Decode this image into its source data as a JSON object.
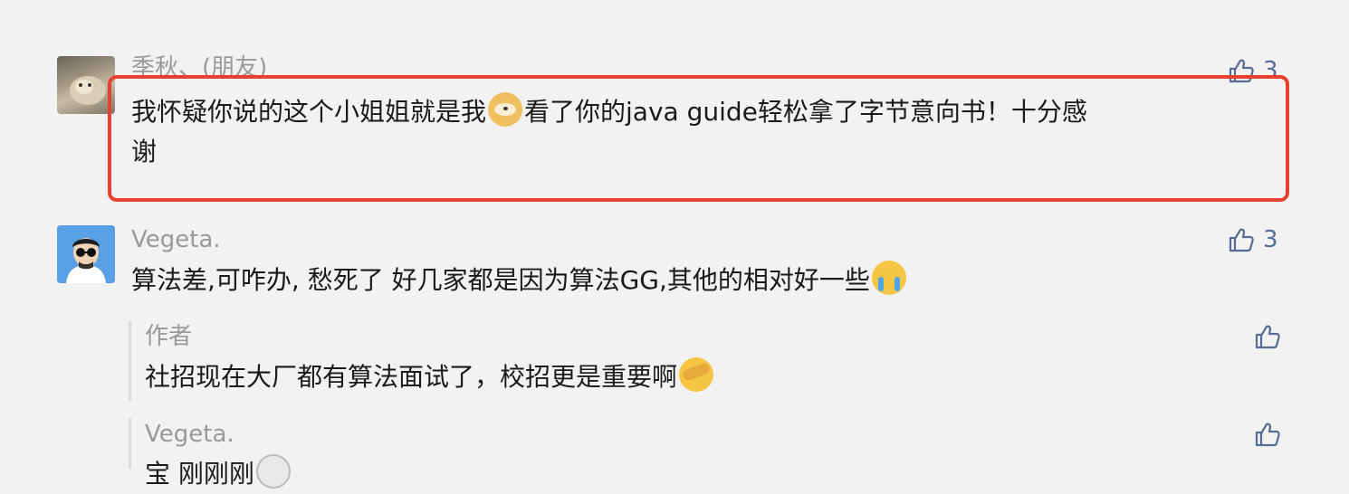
{
  "comments": [
    {
      "user": "季秋、(朋友)",
      "text_before": "我怀疑你说的这个小姐姐就是我",
      "text_after": "看了你的java guide轻松拿了字节意向书！十分感",
      "text_line2": "谢",
      "emoji": "doge-emoji",
      "likes": "3"
    },
    {
      "user": "Vegeta.",
      "text": "算法差,可咋办, 愁死了 好几家都是因为算法GG,其他的相对好一些",
      "emoji": "crying-emoji",
      "likes": "3",
      "replies": [
        {
          "user": "作者",
          "text": "社招现在大厂都有算法面试了，校招更是重要啊",
          "emoji": "facepalm-emoji"
        },
        {
          "user": "Vegeta.",
          "text": "宝 刚刚刚",
          "emoji": "eye-emoji"
        }
      ]
    }
  ],
  "colors": {
    "background": "#f2f2f2",
    "highlight_border": "#e5412f",
    "like_blue": "#576b95",
    "name_gray": "#999999",
    "text": "#1a1a1a"
  }
}
